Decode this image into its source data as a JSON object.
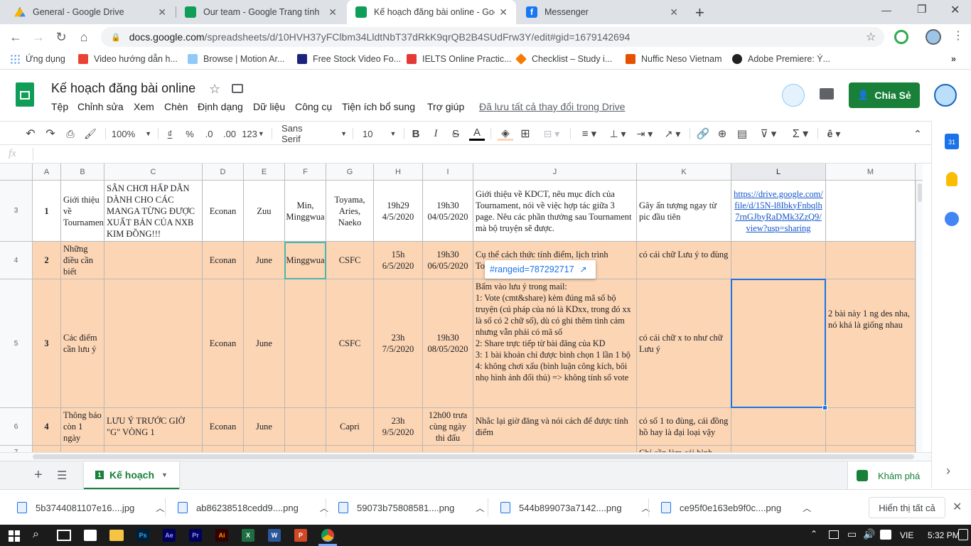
{
  "browser": {
    "tabs": [
      {
        "title": "General - Google Drive",
        "favicon": "drive-icon",
        "color": "#1a73e8"
      },
      {
        "title": "Our team - Google Trang tính",
        "favicon": "sheets-icon",
        "color": "#0f9d58"
      },
      {
        "title": "Kế hoạch đăng bài online - Goog",
        "favicon": "sheets-icon",
        "color": "#0f9d58"
      },
      {
        "title": "Messenger",
        "favicon": "facebook-icon",
        "color": "#1877f2"
      }
    ],
    "new_tab_label": "+",
    "url_host": "docs.google.com",
    "url_path": "/spreadsheets/d/10HVH37yFClbm34LldtNbT37dRkK9qrQB2B4SUdFrw3Y/edit#gid=1679142694",
    "bookmarks": [
      {
        "label": "Ứng dụng",
        "icon": "apps-icon",
        "color": "#4285f4"
      },
      {
        "label": "Video hướng dẫn h...",
        "icon": "video-icon",
        "color": "#ea4335"
      },
      {
        "label": "Browse | Motion Ar...",
        "icon": "motion-icon",
        "color": "#4285f4"
      },
      {
        "label": "Free Stock Video Fo...",
        "icon": "v-icon",
        "color": "#1a237e"
      },
      {
        "label": "IELTS Online Practic...",
        "icon": "ielts-icon",
        "color": "#e53935"
      },
      {
        "label": "Checklist – Study i...",
        "icon": "checklist-icon",
        "color": "#f57c00"
      },
      {
        "label": "Nuffic Neso Vietnam",
        "icon": "nuffic-icon",
        "color": "#e65100"
      },
      {
        "label": "Adobe Premiere: Ý...",
        "icon": "adobe-icon",
        "color": "#212121"
      }
    ],
    "more_bookmarks": "»"
  },
  "sheets": {
    "title": "Kế hoạch đăng bài online",
    "menu": [
      "Tệp",
      "Chỉnh sửa",
      "Xem",
      "Chèn",
      "Định dạng",
      "Dữ liệu",
      "Công cụ",
      "Tiện ích bổ sung",
      "Trợ giúp"
    ],
    "save_status": "Đã lưu tất cả thay đổi trong Drive",
    "share_label": "Chia Sẻ",
    "accent": "#188038",
    "toolbar": {
      "zoom": "100%",
      "currency": "₫",
      "percent": "%",
      "dec_less": ".0",
      "dec_more": ".00",
      "format_more": "123",
      "font": "Sans Serif",
      "font_size": "10",
      "bold": "B",
      "italic": "I",
      "strike": "S",
      "text_color": "A"
    },
    "formula_icon": "fx",
    "columns": [
      "A",
      "B",
      "C",
      "D",
      "E",
      "F",
      "G",
      "H",
      "I",
      "J",
      "K",
      "L",
      "M"
    ],
    "rows": [
      {
        "num": "3",
        "cells": [
          "1",
          "Giới thiệu về Tournament",
          "SÂN CHƠI HẤP DẪN DÀNH CHO CÁC MANGA TỪNG ĐƯỢC XUẤT BẢN CỦA NXB KIM ĐỒNG!!!",
          "Econan",
          "Zuu",
          "Min, Minggwua",
          "Toyama, Aries, Naeko",
          "19h29 4/5/2020",
          "19h30 04/05/2020",
          "Giới thiệu về KDCT, nêu mục đích của Tournament, nói về việc hợp tác giữa 3 page. Nêu các phần thưởng sau Tournament mà bộ truyện sẽ được.",
          "Gây ấn tượng ngay từ pic đầu tiên",
          "https://drive.google.com/file/d/15N-l8IbkyFnbqlh7rnGJbyRaDMk3ZzQ9/view?usp=sharing",
          ""
        ]
      },
      {
        "num": "4",
        "cells": [
          "2",
          "Những điều cần biết",
          "",
          "Econan",
          "June",
          "Minggwua",
          "CSFC",
          "15h 6/5/2020",
          "19h30 06/05/2020",
          "Cụ thể cách thức tính điểm, lịch trình Tournament",
          "có cái chữ Lưu ý to đùng",
          "",
          ""
        ]
      },
      {
        "num": "5",
        "cells": [
          "3",
          "Các điểm cần lưu ý",
          "",
          "Econan",
          "June",
          "",
          "CSFC",
          "23h 7/5/2020",
          "19h30 08/05/2020",
          "Bấm vào lưu ý trong mail:\n1: Vote (cmt&share) kèm đúng mã số bộ truyện (cú pháp của nó là KDxx, trong đó xx là số có 2 chữ số), dù có ghi thêm tình cảm nhưng vẫn phải có mã số\n2: Share trực tiếp từ bài đăng của KD\n3: 1 bài khoản chỉ được bình chọn 1 lần 1 bộ\n4: không chơi xấu (bình luận công kích, bôi nhọ hình ảnh đối thủ) => không tính số vote",
          "có cái chữ x to như chữ Lưu ý",
          "",
          "2 bài này 1 ng des nha, nó khá là giống nhau"
        ]
      },
      {
        "num": "6",
        "cells": [
          "4",
          "Thông báo còn 1 ngày",
          "LƯU Ý TRƯỚC GIỜ \"G\" VÒNG 1",
          "Econan",
          "June",
          "",
          "Capri",
          "23h 9/5/2020",
          "12h00 trưa cùng ngày thi đấu",
          "Nhắc lại giờ đăng và nói cách để được tính điểm",
          "có số 1 to đùng, cái đồng hồ hay là đại loại vậy",
          "",
          ""
        ]
      },
      {
        "num": "7",
        "cells": [
          "",
          "",
          "",
          "",
          "",
          "",
          "",
          "",
          "",
          "",
          "Chỉ cần làm cái hình",
          "",
          ""
        ]
      }
    ],
    "row_fill": "#fcd5b4",
    "range_popup": "#rangeid=787292717",
    "sheet_tab": "Kế hoạch",
    "explore_label": "Khám phá"
  },
  "downloads": {
    "files": [
      "5b3744081107e16....jpg",
      "ab86238518cedd9....png",
      "59073b75808581....png",
      "544b899073a7142....png",
      "ce95f0e163eb9f0c....png"
    ],
    "show_all": "Hiển thị tất cả"
  },
  "taskbar": {
    "apps": [
      {
        "label": "Ps",
        "color": "#31a8ff",
        "bg": "#001e36"
      },
      {
        "label": "Ae",
        "color": "#9999ff",
        "bg": "#00005b"
      },
      {
        "label": "Pr",
        "color": "#9999ff",
        "bg": "#00005b"
      },
      {
        "label": "Ai",
        "color": "#ff9a00",
        "bg": "#330000"
      },
      {
        "label": "X",
        "color": "#fff",
        "bg": "#1d6f42"
      },
      {
        "label": "W",
        "color": "#fff",
        "bg": "#2b579a"
      },
      {
        "label": "P",
        "color": "#fff",
        "bg": "#d24726"
      }
    ],
    "lang": "VIE",
    "time": "5:32 PM"
  }
}
